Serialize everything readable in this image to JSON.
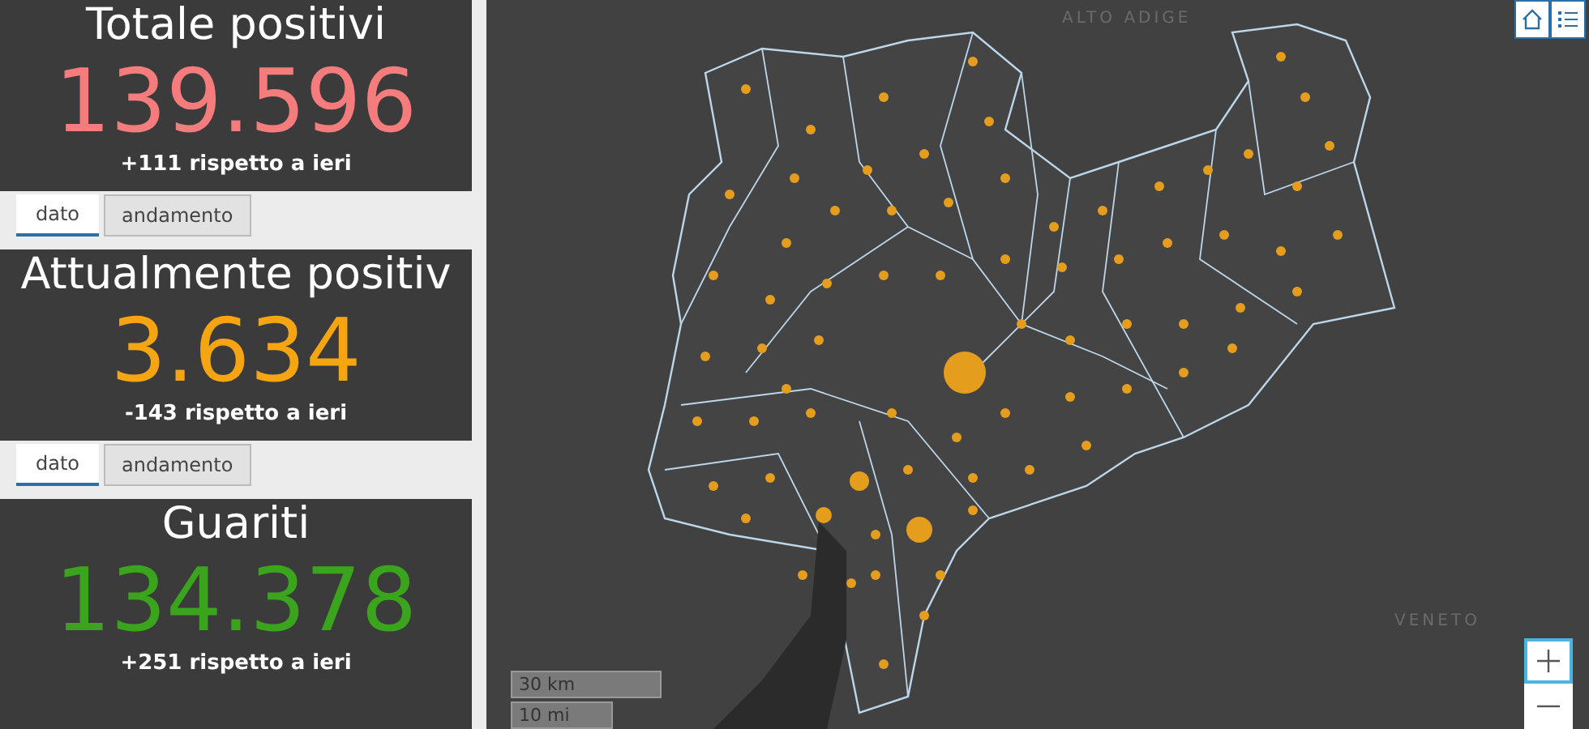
{
  "cards": [
    {
      "title": "Totale positivi",
      "value": "139.596",
      "delta": "+111 rispetto a ieri",
      "color": "#f47c7c",
      "tabs": [
        {
          "label": "dato",
          "selected": true
        },
        {
          "label": "andamento",
          "selected": false
        }
      ]
    },
    {
      "title": "Attualmente positiv",
      "value": "3.634",
      "delta": "-143 rispetto a ieri",
      "color": "#f5a511",
      "tabs": [
        {
          "label": "dato",
          "selected": true
        },
        {
          "label": "andamento",
          "selected": false
        }
      ]
    },
    {
      "title": "Guariti",
      "value": "134.378",
      "delta": "+251 rispetto a ieri",
      "color": "#3aa51c"
    }
  ],
  "map": {
    "labels": [
      "ALTO ADIGE",
      "VENETO"
    ],
    "scale_bar": [
      "30 km",
      "10 mi"
    ]
  }
}
